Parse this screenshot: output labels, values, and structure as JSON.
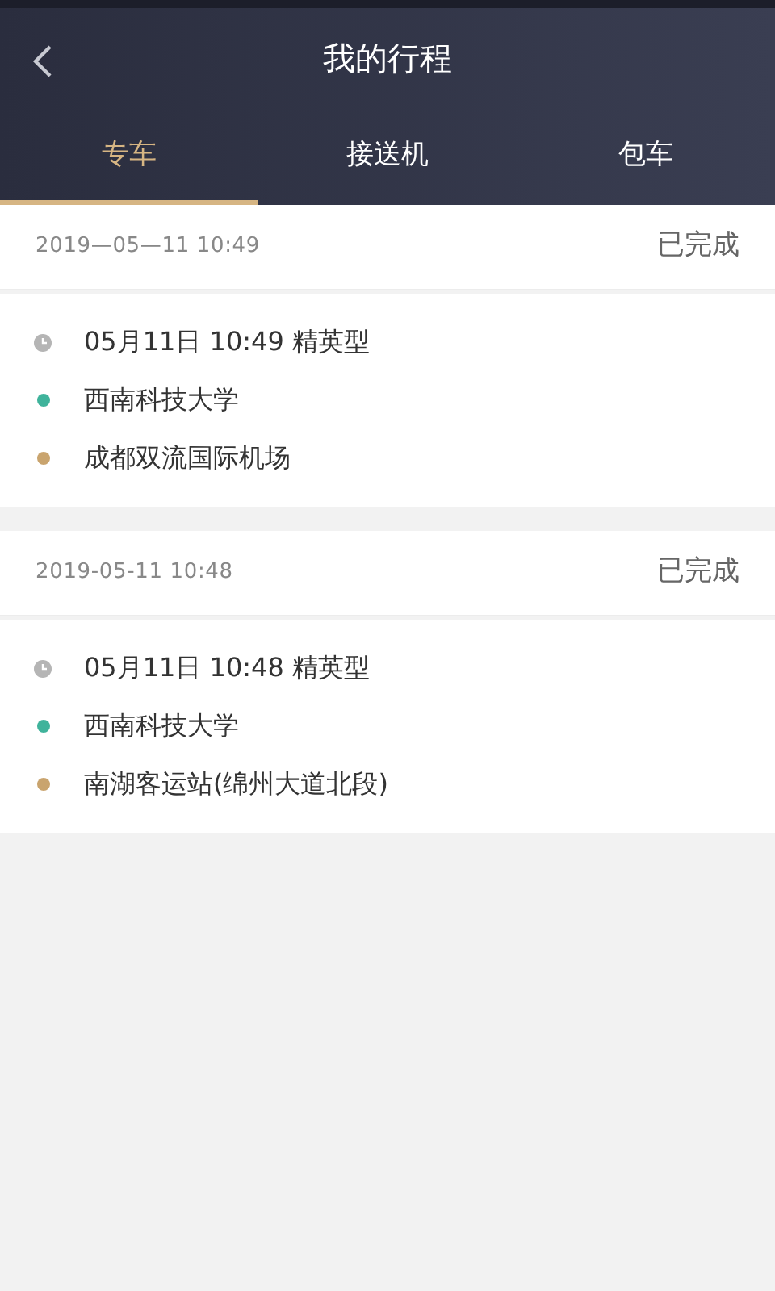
{
  "header": {
    "title": "我的行程"
  },
  "tabs": [
    {
      "label": "专车",
      "selected": true
    },
    {
      "label": "接送机",
      "selected": false
    },
    {
      "label": "包车",
      "selected": false
    }
  ],
  "trips": [
    {
      "date": "2019—05—11 10:49",
      "status": "已完成",
      "rows": [
        {
          "kind": "time",
          "text": "05月11日 10:49 精英型"
        },
        {
          "kind": "place",
          "text": "西南科技大学",
          "color": "#3fb39b"
        },
        {
          "kind": "place",
          "text": "成都双流国际机场",
          "color": "#c9a46e"
        }
      ]
    },
    {
      "date": "2019-05-11 10:48",
      "status": "已完成",
      "rows": [
        {
          "kind": "time",
          "text": "05月11日 10:48 精英型"
        },
        {
          "kind": "place",
          "text": "西南科技大学",
          "color": "#3fb39b"
        },
        {
          "kind": "place",
          "text": "南湖客运站(绵州大道北段)",
          "color": "#c9a46e"
        }
      ]
    }
  ]
}
